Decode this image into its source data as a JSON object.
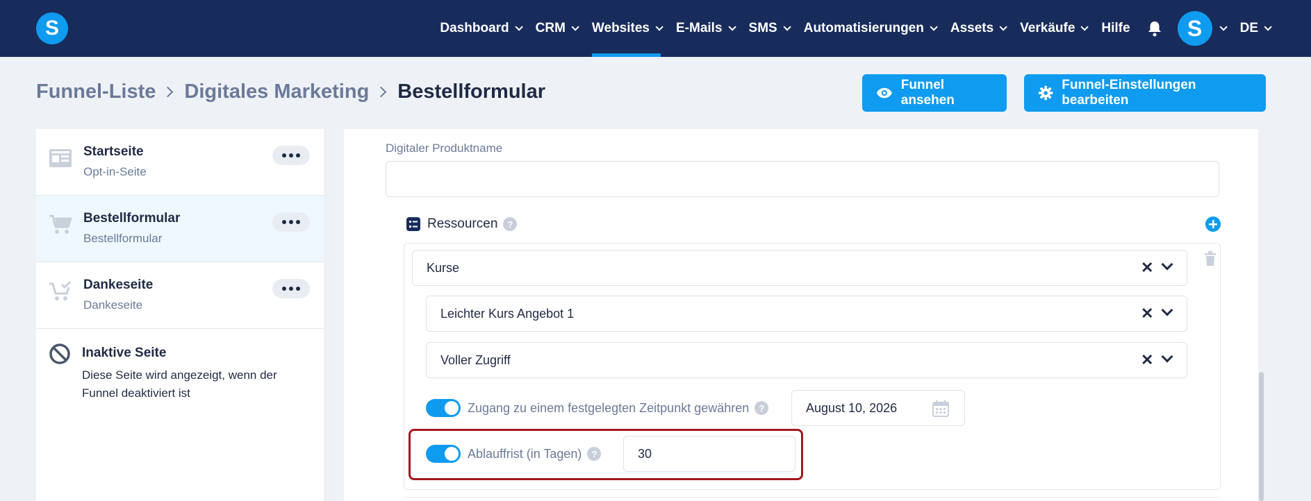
{
  "nav": {
    "logo": "S",
    "items": [
      {
        "label": "Dashboard",
        "has_dropdown": true,
        "active": false
      },
      {
        "label": "CRM",
        "has_dropdown": true,
        "active": false
      },
      {
        "label": "Websites",
        "has_dropdown": true,
        "active": true
      },
      {
        "label": "E-Mails",
        "has_dropdown": true,
        "active": false
      },
      {
        "label": "SMS",
        "has_dropdown": true,
        "active": false
      },
      {
        "label": "Automatisierungen",
        "has_dropdown": true,
        "active": false
      },
      {
        "label": "Assets",
        "has_dropdown": true,
        "active": false
      },
      {
        "label": "Verkäufe",
        "has_dropdown": true,
        "active": false
      },
      {
        "label": "Hilfe",
        "has_dropdown": false,
        "active": false
      }
    ],
    "avatar": "S",
    "language": "DE"
  },
  "breadcrumb": {
    "items": [
      "Funnel-Liste",
      "Digitales Marketing",
      "Bestellformular"
    ]
  },
  "actions": {
    "view_funnel": "Funnel ansehen",
    "edit_settings": "Funnel-Einstellungen bearbeiten"
  },
  "pages": [
    {
      "title": "Startseite",
      "subtitle": "Opt-in-Seite",
      "active": false,
      "icon": "page-layout-icon"
    },
    {
      "title": "Bestellformular",
      "subtitle": "Bestellformular",
      "active": true,
      "icon": "cart-icon"
    },
    {
      "title": "Dankeseite",
      "subtitle": "Dankeseite",
      "active": false,
      "icon": "cart-check-icon"
    }
  ],
  "inactive_page": {
    "title": "Inaktive Seite",
    "description": "Diese Seite wird angezeigt, wenn der Funnel deaktiviert ist"
  },
  "form": {
    "product_name_label": "Digitaler Produktname",
    "product_name_value": "",
    "resources_label": "Ressourcen",
    "resource_type": "Kurse",
    "course_offer": "Leichter Kurs Angebot 1",
    "access_level": "Voller Zugriff",
    "fixed_time_label": "Zugang zu einem festgelegten Zeitpunkt gewähren",
    "fixed_time_enabled": true,
    "fixed_date": "August 10, 2026",
    "expiry_label": "Ablauffrist (in Tagen)",
    "expiry_enabled": true,
    "expiry_days": "30"
  },
  "colors": {
    "nav_bg": "#182c5c",
    "accent": "#0f9bef",
    "highlight": "#a3181e"
  }
}
